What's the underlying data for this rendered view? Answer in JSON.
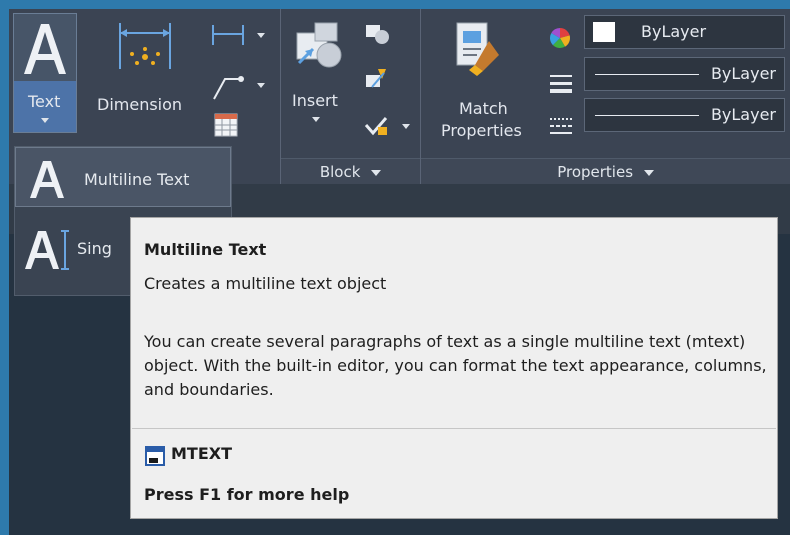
{
  "ribbon": {
    "annotation": {
      "text_button_label": "Text",
      "dimension_button_label": "Dimension"
    },
    "block": {
      "insert_button_label": "Insert",
      "panel_title": "Block"
    },
    "properties": {
      "match_button_label_1": "Match",
      "match_button_label_2": "Properties",
      "panel_title": "Properties",
      "color_value": "ByLayer",
      "linetype_value": "ByLayer",
      "lineweight_value": "ByLayer"
    }
  },
  "dropdown": {
    "items": [
      {
        "label": "Multiline Text"
      },
      {
        "label": "Sing"
      }
    ]
  },
  "tooltip": {
    "title": "Multiline Text",
    "description": "Creates a multiline text object",
    "details": "You can create several paragraphs of text as a single multiline text (mtext) object. With the built-in editor, you can format the text appearance, columns, and boundaries.",
    "command": "MTEXT",
    "help": "Press F1 for more help"
  },
  "icons": {
    "text": "text-A-icon",
    "dimension": "linear-dimension-icon",
    "leader": "leader-icon",
    "table": "table-icon",
    "insert": "insert-block-icon",
    "create_block": "create-block-icon",
    "edit_block": "edit-block-icon",
    "block_attribute": "block-attribute-icon",
    "match_properties": "match-properties-brush-icon",
    "color_wheel": "color-wheel-icon",
    "lineweight": "lineweight-icon",
    "linetype": "linetype-icon",
    "mtext_command": "mtext-command-icon"
  },
  "colors": {
    "ribbon_bg": "#3b4453",
    "app_bg": "#253341",
    "accent": "#4d73a8",
    "tooltip_bg": "#efefef",
    "frame": "#2e7aac"
  }
}
